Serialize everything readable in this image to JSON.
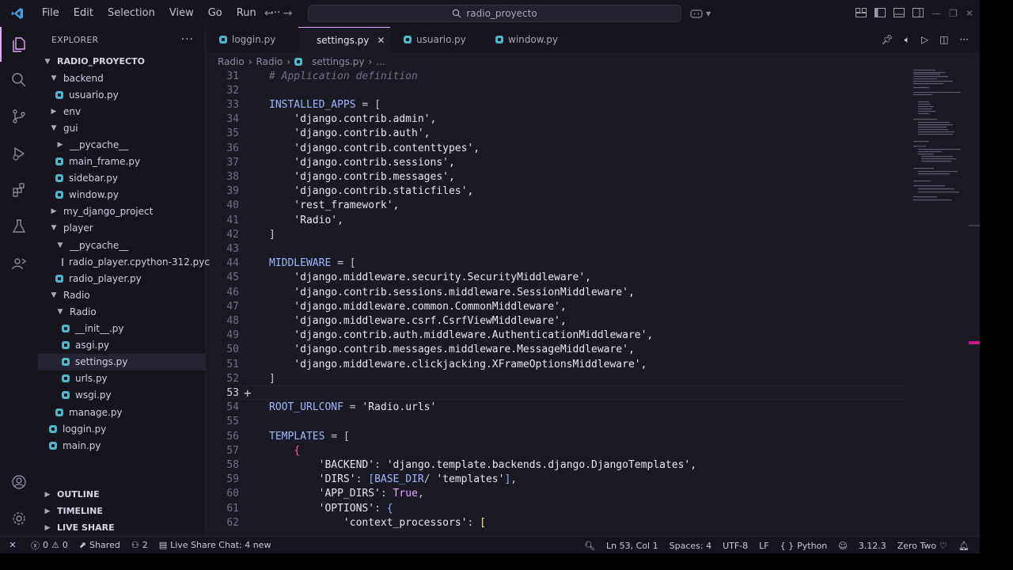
{
  "titlebar": {
    "menu": [
      "File",
      "Edit",
      "Selection",
      "View",
      "Go",
      "Run",
      "···"
    ],
    "search_text": "radio_proyecto"
  },
  "sidebar": {
    "title": "EXPLORER",
    "more": "···",
    "root": "RADIO_PROYECTO",
    "tree": [
      {
        "label": "backend",
        "type": "folder",
        "open": true,
        "indent": 1
      },
      {
        "label": "usuario.py",
        "type": "py",
        "indent": 2
      },
      {
        "label": "env",
        "type": "folder",
        "open": false,
        "indent": 1
      },
      {
        "label": "gui",
        "type": "folder",
        "open": true,
        "indent": 1
      },
      {
        "label": "__pycache__",
        "type": "folder",
        "open": false,
        "indent": 2
      },
      {
        "label": "main_frame.py",
        "type": "py",
        "indent": 2
      },
      {
        "label": "sidebar.py",
        "type": "py",
        "indent": 2
      },
      {
        "label": "window.py",
        "type": "py",
        "indent": 2
      },
      {
        "label": "my_django_project",
        "type": "folder",
        "open": false,
        "indent": 1
      },
      {
        "label": "player",
        "type": "folder",
        "open": true,
        "indent": 1
      },
      {
        "label": "__pycache__",
        "type": "folder",
        "open": true,
        "indent": 2
      },
      {
        "label": "radio_player.cpython-312.pyc",
        "type": "pyc",
        "indent": 3
      },
      {
        "label": "radio_player.py",
        "type": "py",
        "indent": 2
      },
      {
        "label": "Radio",
        "type": "folder",
        "open": true,
        "indent": 1
      },
      {
        "label": "Radio",
        "type": "folder",
        "open": true,
        "indent": 2
      },
      {
        "label": "__init__.py",
        "type": "py",
        "indent": 3
      },
      {
        "label": "asgi.py",
        "type": "py",
        "indent": 3
      },
      {
        "label": "settings.py",
        "type": "py",
        "indent": 3,
        "selected": true
      },
      {
        "label": "urls.py",
        "type": "py",
        "indent": 3
      },
      {
        "label": "wsgi.py",
        "type": "py",
        "indent": 3
      },
      {
        "label": "manage.py",
        "type": "py",
        "indent": 2
      },
      {
        "label": "loggin.py",
        "type": "py",
        "indent": 1
      },
      {
        "label": "main.py",
        "type": "py",
        "indent": 1
      }
    ],
    "panels": [
      "OUTLINE",
      "TIMELINE",
      "LIVE SHARE"
    ]
  },
  "tabs": [
    {
      "label": "loggin.py",
      "active": false
    },
    {
      "label": "settings.py",
      "active": true
    },
    {
      "label": "usuario.py",
      "active": false
    },
    {
      "label": "window.py",
      "active": false
    }
  ],
  "breadcrumb": [
    "Radio",
    ">",
    "Radio",
    ">",
    "settings.py",
    ">",
    "..."
  ],
  "editor": {
    "current_line": 53,
    "lines": [
      {
        "n": "31",
        "tokens": [
          {
            "t": "# Application definition",
            "c": "c-comment"
          }
        ]
      },
      {
        "n": "32",
        "tokens": []
      },
      {
        "n": "33",
        "tokens": [
          {
            "t": "INSTALLED_APPS",
            "c": "c-var"
          },
          {
            "t": " = ",
            "c": "c-op"
          },
          {
            "t": "[",
            "c": "c-op"
          }
        ]
      },
      {
        "n": "34",
        "tokens": [
          {
            "t": "    'django.contrib.admin',",
            "c": "c-str"
          }
        ]
      },
      {
        "n": "35",
        "tokens": [
          {
            "t": "    'django.contrib.auth',",
            "c": "c-str"
          }
        ]
      },
      {
        "n": "36",
        "tokens": [
          {
            "t": "    'django.contrib.contenttypes',",
            "c": "c-str"
          }
        ]
      },
      {
        "n": "37",
        "tokens": [
          {
            "t": "    'django.contrib.sessions',",
            "c": "c-str"
          }
        ]
      },
      {
        "n": "38",
        "tokens": [
          {
            "t": "    'django.contrib.messages',",
            "c": "c-str"
          }
        ]
      },
      {
        "n": "39",
        "tokens": [
          {
            "t": "    'django.contrib.staticfiles',",
            "c": "c-str"
          }
        ]
      },
      {
        "n": "40",
        "tokens": [
          {
            "t": "    'rest_framework',",
            "c": "c-str"
          }
        ]
      },
      {
        "n": "41",
        "tokens": [
          {
            "t": "    'Radio',",
            "c": "c-str"
          }
        ]
      },
      {
        "n": "42",
        "tokens": [
          {
            "t": "]",
            "c": "c-op"
          }
        ]
      },
      {
        "n": "43",
        "tokens": []
      },
      {
        "n": "44",
        "tokens": [
          {
            "t": "MIDDLEWARE",
            "c": "c-var"
          },
          {
            "t": " = ",
            "c": "c-op"
          },
          {
            "t": "[",
            "c": "c-op"
          }
        ]
      },
      {
        "n": "45",
        "tokens": [
          {
            "t": "    'django.middleware.security.SecurityMiddleware',",
            "c": "c-str"
          }
        ]
      },
      {
        "n": "46",
        "tokens": [
          {
            "t": "    'django.contrib.sessions.middleware.SessionMiddleware',",
            "c": "c-str"
          }
        ]
      },
      {
        "n": "47",
        "tokens": [
          {
            "t": "    'django.middleware.common.CommonMiddleware',",
            "c": "c-str"
          }
        ]
      },
      {
        "n": "48",
        "tokens": [
          {
            "t": "    'django.middleware.csrf.CsrfViewMiddleware',",
            "c": "c-str"
          }
        ]
      },
      {
        "n": "49",
        "tokens": [
          {
            "t": "    'django.contrib.auth.middleware.AuthenticationMiddleware',",
            "c": "c-str"
          }
        ]
      },
      {
        "n": "50",
        "tokens": [
          {
            "t": "    'django.contrib.messages.middleware.MessageMiddleware',",
            "c": "c-str"
          }
        ]
      },
      {
        "n": "51",
        "tokens": [
          {
            "t": "    'django.middleware.clickjacking.XFrameOptionsMiddleware',",
            "c": "c-str"
          }
        ]
      },
      {
        "n": "52",
        "tokens": [
          {
            "t": "]",
            "c": "c-op"
          }
        ]
      },
      {
        "n": "53",
        "tokens": []
      },
      {
        "n": "54",
        "tokens": [
          {
            "t": "ROOT_URLCONF",
            "c": "c-var"
          },
          {
            "t": " = ",
            "c": "c-op"
          },
          {
            "t": "'Radio.urls'",
            "c": "c-str"
          }
        ]
      },
      {
        "n": "55",
        "tokens": []
      },
      {
        "n": "56",
        "tokens": [
          {
            "t": "TEMPLATES",
            "c": "c-var"
          },
          {
            "t": " = ",
            "c": "c-op"
          },
          {
            "t": "[",
            "c": "c-op"
          }
        ]
      },
      {
        "n": "57",
        "tokens": [
          {
            "t": "    ",
            "c": "c-op"
          },
          {
            "t": "{",
            "c": "c-brace"
          }
        ]
      },
      {
        "n": "58",
        "tokens": [
          {
            "t": "        'BACKEND'",
            "c": "c-str"
          },
          {
            "t": ": ",
            "c": "c-op"
          },
          {
            "t": "'django.template.backends.django.DjangoTemplates',",
            "c": "c-str"
          }
        ]
      },
      {
        "n": "59",
        "tokens": [
          {
            "t": "        'DIRS'",
            "c": "c-str"
          },
          {
            "t": ": ",
            "c": "c-op"
          },
          {
            "t": "[",
            "c": "c-blue"
          },
          {
            "t": "BASE_DIR",
            "c": "c-var"
          },
          {
            "t": "/ ",
            "c": "c-op"
          },
          {
            "t": "'templates'",
            "c": "c-str"
          },
          {
            "t": "]",
            "c": "c-blue"
          },
          {
            "t": ",",
            "c": "c-op"
          }
        ]
      },
      {
        "n": "60",
        "tokens": [
          {
            "t": "        'APP_DIRS'",
            "c": "c-str"
          },
          {
            "t": ": ",
            "c": "c-op"
          },
          {
            "t": "True",
            "c": "c-bool"
          },
          {
            "t": ",",
            "c": "c-op"
          }
        ]
      },
      {
        "n": "61",
        "tokens": [
          {
            "t": "        'OPTIONS'",
            "c": "c-str"
          },
          {
            "t": ": ",
            "c": "c-op"
          },
          {
            "t": "{",
            "c": "c-blue"
          }
        ]
      },
      {
        "n": "62",
        "tokens": [
          {
            "t": "            'context_processors'",
            "c": "c-str"
          },
          {
            "t": ": ",
            "c": "c-op"
          },
          {
            "t": "[",
            "c": "c-brack"
          }
        ]
      }
    ]
  },
  "statusbar": {
    "errors": "0",
    "warnings": "0",
    "shared": "Shared",
    "participants": "2",
    "live_share_chat": "Live Share Chat: 4 new",
    "position": "Ln 53, Col 1",
    "spaces": "Spaces: 4",
    "encoding": "UTF-8",
    "eol": "LF",
    "language": "Python",
    "interpreter": "3.12.3",
    "theme": "Zero Two"
  },
  "colors": {
    "accent": "#e2a7ff",
    "python_icon": "#53b5c9",
    "background": "#1b1a24"
  }
}
